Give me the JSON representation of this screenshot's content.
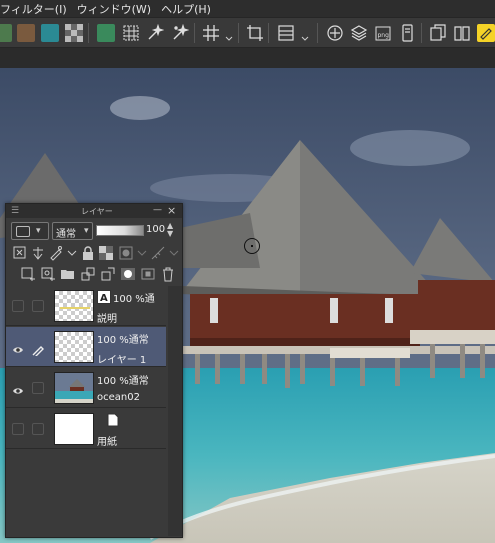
{
  "menu": {
    "items": [
      "フィルター(I)",
      "ウィンドウ(W)",
      "ヘルプ(H)"
    ]
  },
  "toolbar": {
    "icons": [
      "color-swatch-green",
      "color-swatch-brown",
      "color-swatch-teal",
      "transparency-icon",
      "color-swatch-green-2",
      "grid-select-icon",
      "magic-wand-icon",
      "magic-wand-2-icon",
      "grid-icon",
      "crop-icon",
      "panel-layout-icon",
      "ruler-icon",
      "stack-icon",
      "png-export-icon",
      "phone-preview-icon",
      "copy-icon",
      "book-icon",
      "highlight-icon"
    ]
  },
  "layer_panel": {
    "title": "レイヤー",
    "blend_mode": "通常",
    "opacity": "100",
    "layers": [
      {
        "meta": "100 %通",
        "name": "説明",
        "type": "text",
        "visible": false,
        "selected": false
      },
      {
        "meta": "100 %通常",
        "name": "レイヤー 1",
        "type": "raster",
        "visible": true,
        "selected": true
      },
      {
        "meta": "100 %通常",
        "name": "ocean02",
        "type": "image",
        "visible": true,
        "selected": false
      },
      {
        "meta": "",
        "name": "用紙",
        "type": "paper",
        "visible": false,
        "selected": false
      }
    ]
  },
  "colors": {
    "menubar_bg": "#2d2d2d",
    "toolbar_bg": "#393939",
    "panel_bg": "#3a3a3a",
    "selection": "#4f5a76",
    "highlight_yellow": "#f5d327"
  }
}
